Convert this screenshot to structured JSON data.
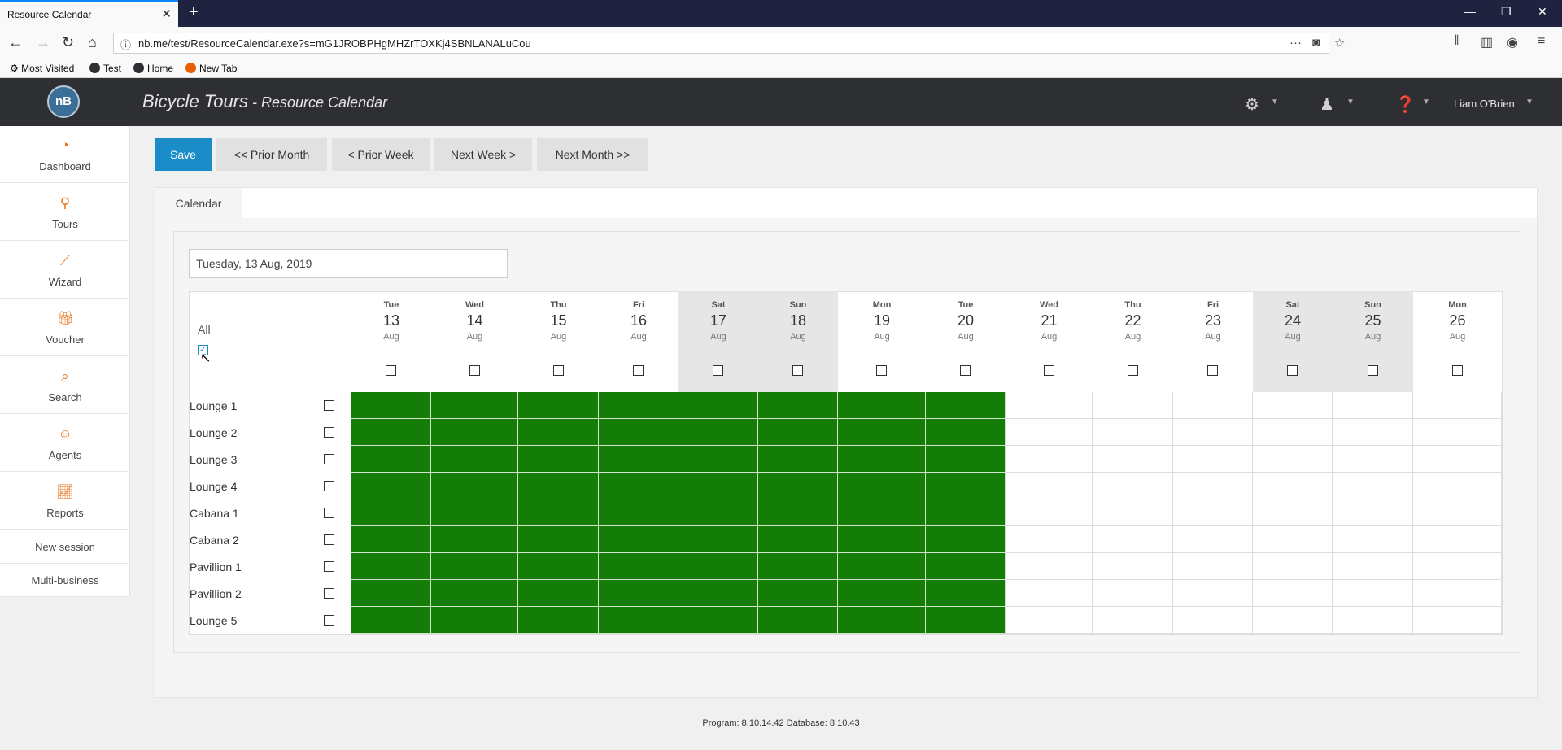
{
  "browser": {
    "tab_title": "Resource Calendar",
    "url": "nb.me/test/ResourceCalendar.exe?s=mG1JROBPHgMHZrTOXKj4SBNLANALuCou",
    "bookmarks": [
      "Most Visited",
      "Test",
      "Home",
      "New Tab"
    ]
  },
  "header": {
    "app_name": "Bicycle Tours",
    "separator": " - ",
    "page_name": "Resource Calendar",
    "logo_text": "nB",
    "user": "Liam O'Brien"
  },
  "sidebar": {
    "items": [
      {
        "label": "Dashboard",
        "icon": "gauge-icon"
      },
      {
        "label": "Tours",
        "icon": "tours-icon"
      },
      {
        "label": "Wizard",
        "icon": "wand-icon"
      },
      {
        "label": "Voucher",
        "icon": "gift-icon"
      },
      {
        "label": "Search",
        "icon": "search-icon"
      },
      {
        "label": "Agents",
        "icon": "agent-icon"
      },
      {
        "label": "Reports",
        "icon": "chart-icon"
      }
    ],
    "links": [
      "New session",
      "Multi-business"
    ]
  },
  "toolbar": {
    "save": "Save",
    "prior_month": "<< Prior Month",
    "prior_week": "< Prior Week",
    "next_week": "Next Week >",
    "next_month": "Next Month >>"
  },
  "tabs": {
    "calendar": "Calendar"
  },
  "date_field": {
    "value": "Tuesday, 13 Aug, 2019"
  },
  "calendar": {
    "all_label": "All",
    "all_checked": true,
    "days": [
      {
        "dow": "Tue",
        "day": "13",
        "mon": "Aug",
        "weekend": false
      },
      {
        "dow": "Wed",
        "day": "14",
        "mon": "Aug",
        "weekend": false
      },
      {
        "dow": "Thu",
        "day": "15",
        "mon": "Aug",
        "weekend": false
      },
      {
        "dow": "Fri",
        "day": "16",
        "mon": "Aug",
        "weekend": false
      },
      {
        "dow": "Sat",
        "day": "17",
        "mon": "Aug",
        "weekend": true
      },
      {
        "dow": "Sun",
        "day": "18",
        "mon": "Aug",
        "weekend": true
      },
      {
        "dow": "Mon",
        "day": "19",
        "mon": "Aug",
        "weekend": false
      },
      {
        "dow": "Tue",
        "day": "20",
        "mon": "Aug",
        "weekend": false
      },
      {
        "dow": "Wed",
        "day": "21",
        "mon": "Aug",
        "weekend": false
      },
      {
        "dow": "Thu",
        "day": "22",
        "mon": "Aug",
        "weekend": false
      },
      {
        "dow": "Fri",
        "day": "23",
        "mon": "Aug",
        "weekend": false
      },
      {
        "dow": "Sat",
        "day": "24",
        "mon": "Aug",
        "weekend": true
      },
      {
        "dow": "Sun",
        "day": "25",
        "mon": "Aug",
        "weekend": true
      },
      {
        "dow": "Mon",
        "day": "26",
        "mon": "Aug",
        "weekend": false
      }
    ],
    "resources": [
      "Lounge 1",
      "Lounge 2",
      "Lounge 3",
      "Lounge 4",
      "Cabana 1",
      "Cabana 2",
      "Pavillion 1",
      "Pavillion 2",
      "Lounge 5"
    ],
    "available_days": 8,
    "available_color": "#137d07"
  },
  "footer": "Program: 8.10.14.42 Database: 8.10.43"
}
